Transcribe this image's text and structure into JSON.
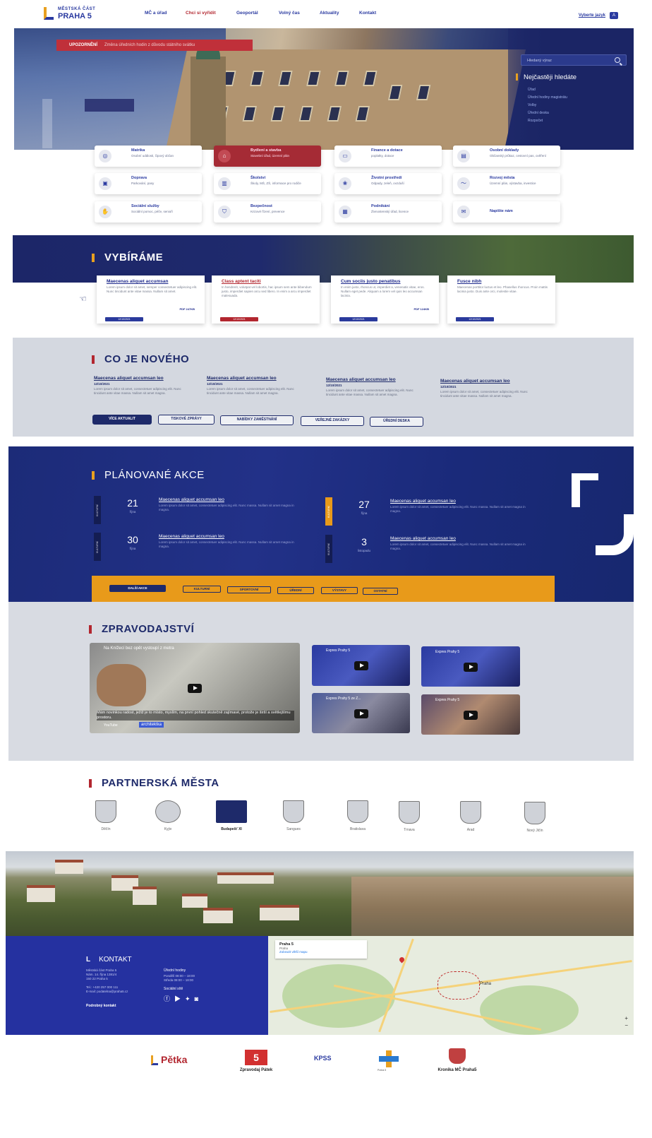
{
  "header": {
    "logo_line1": "MĚSTSKÁ ČÁST",
    "logo_line2": "PRAHA 5",
    "nav": [
      "MČ a úřad",
      "Chci si vyřídit",
      "Geoportál",
      "Volný čas",
      "Aktuality",
      "Kontakt"
    ],
    "lang_label": "Vyberte jazyk",
    "lang_icon": "translate-icon"
  },
  "hero": {
    "alert_tag": "UPOZORNĚNÍ",
    "alert_text": "Změna úředních hodin z důvodu státního svátku",
    "search_placeholder": "Hledaný výraz",
    "faq_title": "Nejčastěji hledáte",
    "faq_items": [
      "Úřad",
      "Úřední hodiny magistrátu",
      "Volby",
      "Úřední deska",
      "Rozpočet"
    ]
  },
  "services": [
    {
      "title": "Matrika",
      "sub": "Osobní události, čipový občan",
      "icon": "id-card-icon"
    },
    {
      "title": "Bydlení a stavba",
      "sub": "Stavební úřad, územní plán",
      "icon": "home-icon",
      "active": true
    },
    {
      "title": "Finance a dotace",
      "sub": "poplatky, dotace",
      "icon": "money-icon"
    },
    {
      "title": "Osobní doklady",
      "sub": "Občanský průkaz, cestovní pas, ověření",
      "icon": "document-icon"
    },
    {
      "title": "Doprava",
      "sub": "Parkování, pasy",
      "icon": "car-icon"
    },
    {
      "title": "Školství",
      "sub": "Školy, MŠ, ZŠ, informace pro rodiče",
      "icon": "school-icon"
    },
    {
      "title": "Životní prostředí",
      "sub": "Odpady, zeleň, ovzduší",
      "icon": "leaf-icon"
    },
    {
      "title": "Rozvoj města",
      "sub": "Územní plán, výstavba, investice",
      "icon": "chart-icon"
    },
    {
      "title": "Sociální služby",
      "sub": "Sociální pomoc, péče, senioři",
      "icon": "hands-icon"
    },
    {
      "title": "Bezpečnost",
      "sub": "Krizové řízení, prevence",
      "icon": "shield-icon"
    },
    {
      "title": "Podnikání",
      "sub": "Živnostenský úřad, licence",
      "icon": "briefcase-icon"
    },
    {
      "title": "Napište nám",
      "sub": "",
      "icon": "mail-icon"
    }
  ],
  "vybirame": {
    "title": "VYBÍRÁME",
    "cards": [
      {
        "title": "Maecenas aliquet accumsan",
        "text": "Lorem ipsum dolor sit amet, semper consectetuer adipiscing elit. Nunc tincidunt ante vitae massa. Nullam sit amet.",
        "pdf": "PDF 247KB",
        "date": "12/10/2021",
        "red": false
      },
      {
        "title": "Class aptent taciti",
        "text": "In hendrerit, volutpat vel lobortis, hac ipsum sem ante bibendum justo, imperdiet sapien arcu sed libero. In enim a arcu imperdiet malesuada.",
        "pdf": "",
        "date": "12/10/2021",
        "red": true
      },
      {
        "title": "Cum sociis justo penatibus",
        "text": "In enim justo, rhoncus ut, imperdiet a, venenatis vitae, eros. Nullam eget pede. Aliquam a lorem vel quis leo accumsan lacinia.",
        "pdf": "PDF 124KB",
        "date": "12/10/2021",
        "red": false
      },
      {
        "title": "Fusce nibh",
        "text": "Maecenas porttitor luctus et leo. Phasellus rhoncus. Proin mattis lacinia justo. Duis ante orci, molestie vitae.",
        "pdf": "",
        "date": "12/10/2021",
        "red": false
      }
    ]
  },
  "cjn": {
    "title": "CO JE NOVÉHO",
    "items": [
      {
        "title": "Maecenas aliquet accumsan leo",
        "date": "12/10/2021",
        "text": "Lorem ipsum dolor sit amet, consectetuer adipiscing elit. Nunc tincidunt ante vitae massa. Nullam sit amet magna."
      },
      {
        "title": "Maecenas aliquet accumsan leo",
        "date": "12/10/2021",
        "text": "Lorem ipsum dolor sit amet, consectetuer adipiscing elit. Nunc tincidunt ante vitae massa. Nullam sit amet magna."
      },
      {
        "title": "Maecenas aliquet accumsan leo",
        "date": "12/10/2021",
        "text": "Lorem ipsum dolor sit amet, consectetuer adipiscing elit. Nunc tincidunt ante vitae massa. Nullam sit amet magna."
      },
      {
        "title": "Maecenas aliquet accumsan leo",
        "date": "12/10/2021",
        "text": "Lorem ipsum dolor sit amet, consectetuer adipiscing elit. Nunc tincidunt ante vitae massa. Nullam sit amet magna."
      }
    ],
    "buttons": [
      "VÍCE AKTUALIT",
      "TISKOVÉ ZPRÁVY",
      "NABÍDKY ZAMĚSTNÁNÍ",
      "VEŘEJNÉ ZAKÁZKY",
      "ÚŘEDNÍ DESKA"
    ]
  },
  "akce": {
    "title": "PLÁNOVANÉ AKCE",
    "events": [
      {
        "tag": "KULTURNÍ",
        "day": "21",
        "month": "října",
        "title": "Maecenas aliquet accumsan leo",
        "text": "Lorem ipsum dolor sit amet, consectetuer adipiscing elit. Nunc massa. Nullam sit amet magna in magna."
      },
      {
        "tag": "KULTURNÍ",
        "day": "27",
        "month": "října",
        "title": "Maecenas aliquet accumsan leo",
        "text": "Lorem ipsum dolor sit amet, consectetuer adipiscing elit. Nunc massa. Nullam sit amet magna in magna."
      },
      {
        "tag": "KULTURNÍ",
        "day": "30",
        "month": "října",
        "title": "Maecenas aliquet accumsan leo",
        "text": "Lorem ipsum dolor sit amet, consectetuer adipiscing elit. Nunc massa. Nullam sit amet magna in magna."
      },
      {
        "tag": "KULTURNÍ",
        "day": "3",
        "month": "listopadu",
        "title": "Maecenas aliquet accumsan leo",
        "text": "Lorem ipsum dolor sit amet, consectetuer adipiscing elit. Nunc massa. Nullam sit amet magna in magna."
      }
    ],
    "more": "DALŠÍ AKCE",
    "filters": [
      "KULTURNÍ",
      "SPORTOVNÍ",
      "ÚŘEDNÍ",
      "VÝSTAVY",
      "OSTATNÍ"
    ]
  },
  "zpravy": {
    "title": "ZPRAVODAJSTVÍ",
    "main_video_title": "Na Knížecí bez opět vystoupí z metra",
    "main_caption": "Mám novinkou radost, ježiž je to místo, myslím, na první pohled skutečně zajímavé, protože je širší a světlejšímu prostoru.",
    "main_tag": "architektka",
    "youtube_label": "YouTube",
    "side_titles": [
      "Expres Prahy 5",
      "Expres Prahy 5",
      "Expres Prahy 5 ze Z...",
      "Expres Prahy 5"
    ]
  },
  "partneri": {
    "title": "PARTNERSKÁ MĚSTA",
    "cities": [
      "Děčín",
      "Kyjiv",
      "Budapešť XI",
      "Sangues",
      "Bratislava",
      "Trnava",
      "Arad",
      "Nový Jičín"
    ]
  },
  "kontakt": {
    "title": "KONTAKT",
    "address": [
      "Městská část Praha 5",
      "Nám. 14. října 1381/4",
      "150 22 Praha 5"
    ],
    "phone": "Tel.: +420 257 000 111",
    "email": "E-mail: podatelna@praha5.cz",
    "hours_title": "Úřední hodiny",
    "hours": [
      "Pondělí  08:00 – 18:00",
      "Středa  08:00 – 18:00"
    ],
    "social_title": "Sociální sítě",
    "more_link": "Podrobný kontakt",
    "map_title": "Praha 5",
    "map_sub": "Praha",
    "map_link": "Zobrazit větší mapu",
    "map_city": "Praha"
  },
  "footer": [
    "Pětka",
    "Zpravodaj Pátek",
    "KPSS",
    "Praha 5",
    "Kronika MČ Praha5"
  ]
}
